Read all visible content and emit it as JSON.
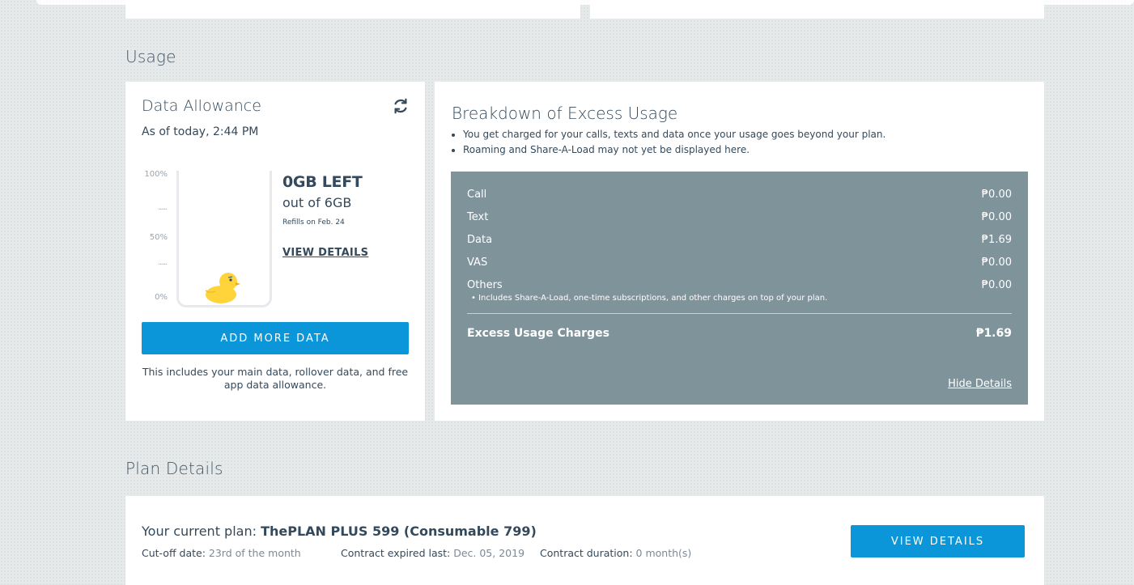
{
  "sections": {
    "usage_title": "Usage",
    "plan_title": "Plan Details"
  },
  "data_allowance": {
    "title": "Data Allowance",
    "as_of": "As of today, 2:44 PM",
    "cup_labels": {
      "top": "100%",
      "mid": "50%",
      "bottom": "0%",
      "dots": "....."
    },
    "remaining": "0GB LEFT",
    "out_of": "out of 6GB",
    "refills": "Refills on Feb. 24",
    "remaining_fraction": 0,
    "view_details": "VIEW DETAILS",
    "add_button": "ADD MORE DATA",
    "note": "This includes your main data, rollover data, and free app data allowance.",
    "icons": {
      "refresh": "refresh-icon",
      "duck": "duck-mascot-icon"
    }
  },
  "breakdown": {
    "title": "Breakdown of Excess Usage",
    "bullets": [
      "You get charged for your calls, texts and data once your usage goes beyond your plan.",
      "Roaming and Share-A-Load may not yet be displayed here."
    ],
    "rows": [
      {
        "label": "Call",
        "value": "₱0.00"
      },
      {
        "label": "Text",
        "value": "₱0.00"
      },
      {
        "label": "Data",
        "value": "₱1.69"
      },
      {
        "label": "VAS",
        "value": "₱0.00"
      },
      {
        "label": "Others",
        "value": "₱0.00"
      }
    ],
    "others_note": "• Includes Share-A-Load, one-time subscriptions, and other charges on top of your plan.",
    "total_label": "Excess Usage Charges",
    "total_value": "₱1.69",
    "hide_details": "Hide Details"
  },
  "plan": {
    "prefix": "Your current plan: ",
    "name": "ThePLAN PLUS 599 (Consumable 799)",
    "cutoff_label": "Cut-off date: ",
    "cutoff_value": "23rd of the month",
    "contract_label": "Contract expired last: ",
    "contract_value": "Dec. 05, 2019",
    "duration_label": "Contract duration: ",
    "duration_value": "0 month(s)",
    "view_button": "VIEW DETAILS"
  },
  "colors": {
    "accent": "#0a96d9",
    "panel": "#7f939b",
    "duck": "#ffd43b"
  }
}
